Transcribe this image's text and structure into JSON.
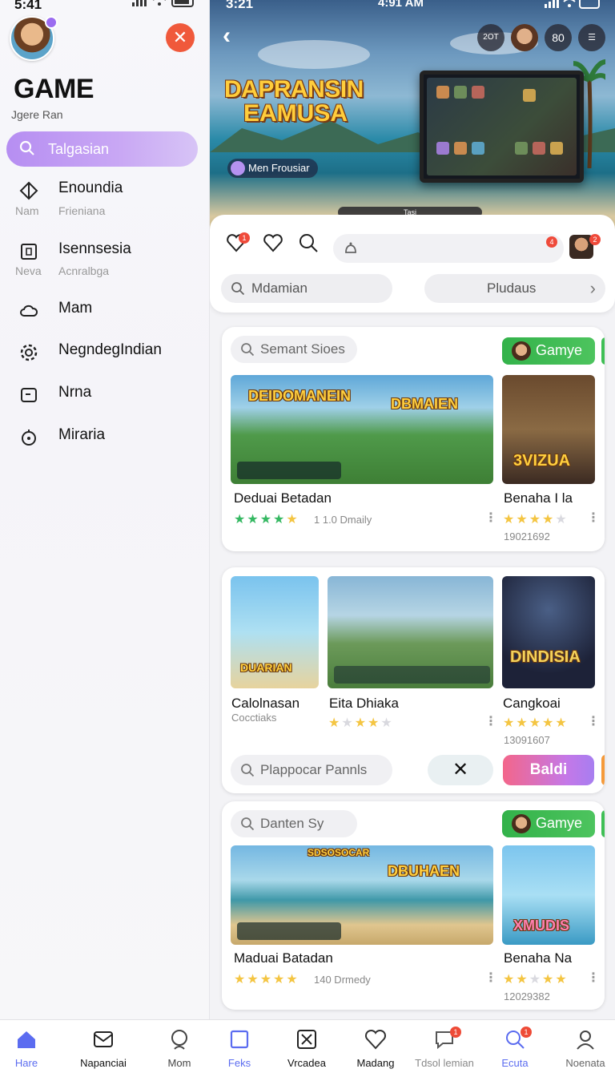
{
  "sidebar": {
    "time": "5:41",
    "title": "GAME",
    "subtitle": "Jgere Ran",
    "search_label": "Talgasian",
    "items": [
      {
        "label": "Enoundia",
        "meta_left": "Nam",
        "meta_right": "Frieniana",
        "icon": "diamond-icon"
      },
      {
        "label": "Isennsesia",
        "meta_left": "Neva",
        "meta_right": "Acnralbga",
        "icon": "box-icon"
      },
      {
        "label": "Mam",
        "icon": "cloud-icon"
      },
      {
        "label": "NegndegIndian",
        "icon": "gear-icon"
      },
      {
        "label": "Nrna",
        "icon": "tv-icon"
      },
      {
        "label": "Miraria",
        "icon": "timer-icon"
      }
    ]
  },
  "hero": {
    "time": "3:21",
    "clock": "4:91 AM",
    "chips": [
      "2OT",
      "",
      "80",
      ""
    ],
    "logo_line1": "DAPRANSIN",
    "logo_line2": "EAMUSA",
    "tag": "Men Frousiar",
    "bar": "Tasi"
  },
  "toolbar": {
    "heart_badge": "1",
    "notif_badge": "4",
    "avatar_badge": "2",
    "pill_left": "Mdamian",
    "pill_right": "Pludaus"
  },
  "cards": [
    {
      "search": "Semant Sioes",
      "button": "Gamye",
      "big": {
        "caption1": "DEIDOMANEIN",
        "caption2": "DBMAIEN",
        "name": "Deduai Betadan",
        "rating": 4.5,
        "meta": "1 1.0 Dmaily"
      },
      "side": {
        "caption": "3VIZUA",
        "name": "Benaha I la",
        "rating": 4.5,
        "meta": "19021692"
      }
    },
    {
      "items": [
        {
          "caption": "DUARIAN",
          "name": "Calolnasan",
          "meta": "Cocctiaks"
        },
        {
          "name": "Eita Dhiaka",
          "rating": 2.5
        },
        {
          "caption": "DINDISIA",
          "name": "Cangkoai",
          "rating": 5,
          "meta": "13091607"
        }
      ],
      "search": "Plappocar Pannls",
      "close": "✕",
      "button": "Baldi"
    },
    {
      "search": "Danten Sy",
      "button": "Gamye",
      "big": {
        "caption1": "SDSOSOCAR",
        "caption2": "DBUHAEN",
        "name": "Maduai Batadan",
        "rating": 4.5,
        "meta": "140 Drmedy"
      },
      "side": {
        "caption": "XMUDIS",
        "name": "Benaha Na",
        "rating": 3.5,
        "meta": "12029382"
      }
    }
  ],
  "bottom_nav": [
    {
      "label": "Hare",
      "icon": "home-icon",
      "active": true
    },
    {
      "label": "Napanciai",
      "icon": "mail-icon"
    },
    {
      "label": "Mom",
      "icon": "profile-icon"
    },
    {
      "label": "Feks",
      "icon": "square-icon"
    },
    {
      "label": "Vrcadea",
      "icon": "tools-icon"
    },
    {
      "label": "Madang",
      "icon": "heart-icon"
    },
    {
      "label": "Tdsol lemian",
      "icon": "chat-icon",
      "badge": "1"
    },
    {
      "label": "Ecuta",
      "icon": "search-icon",
      "badge": "1"
    },
    {
      "label": "Noenata",
      "icon": "user-icon"
    }
  ],
  "colors": {
    "accent": "#b68ef2",
    "close": "#f0593b",
    "green": "#33b24a",
    "star": "#f4c542",
    "nav_active": "#5b6cf0"
  }
}
